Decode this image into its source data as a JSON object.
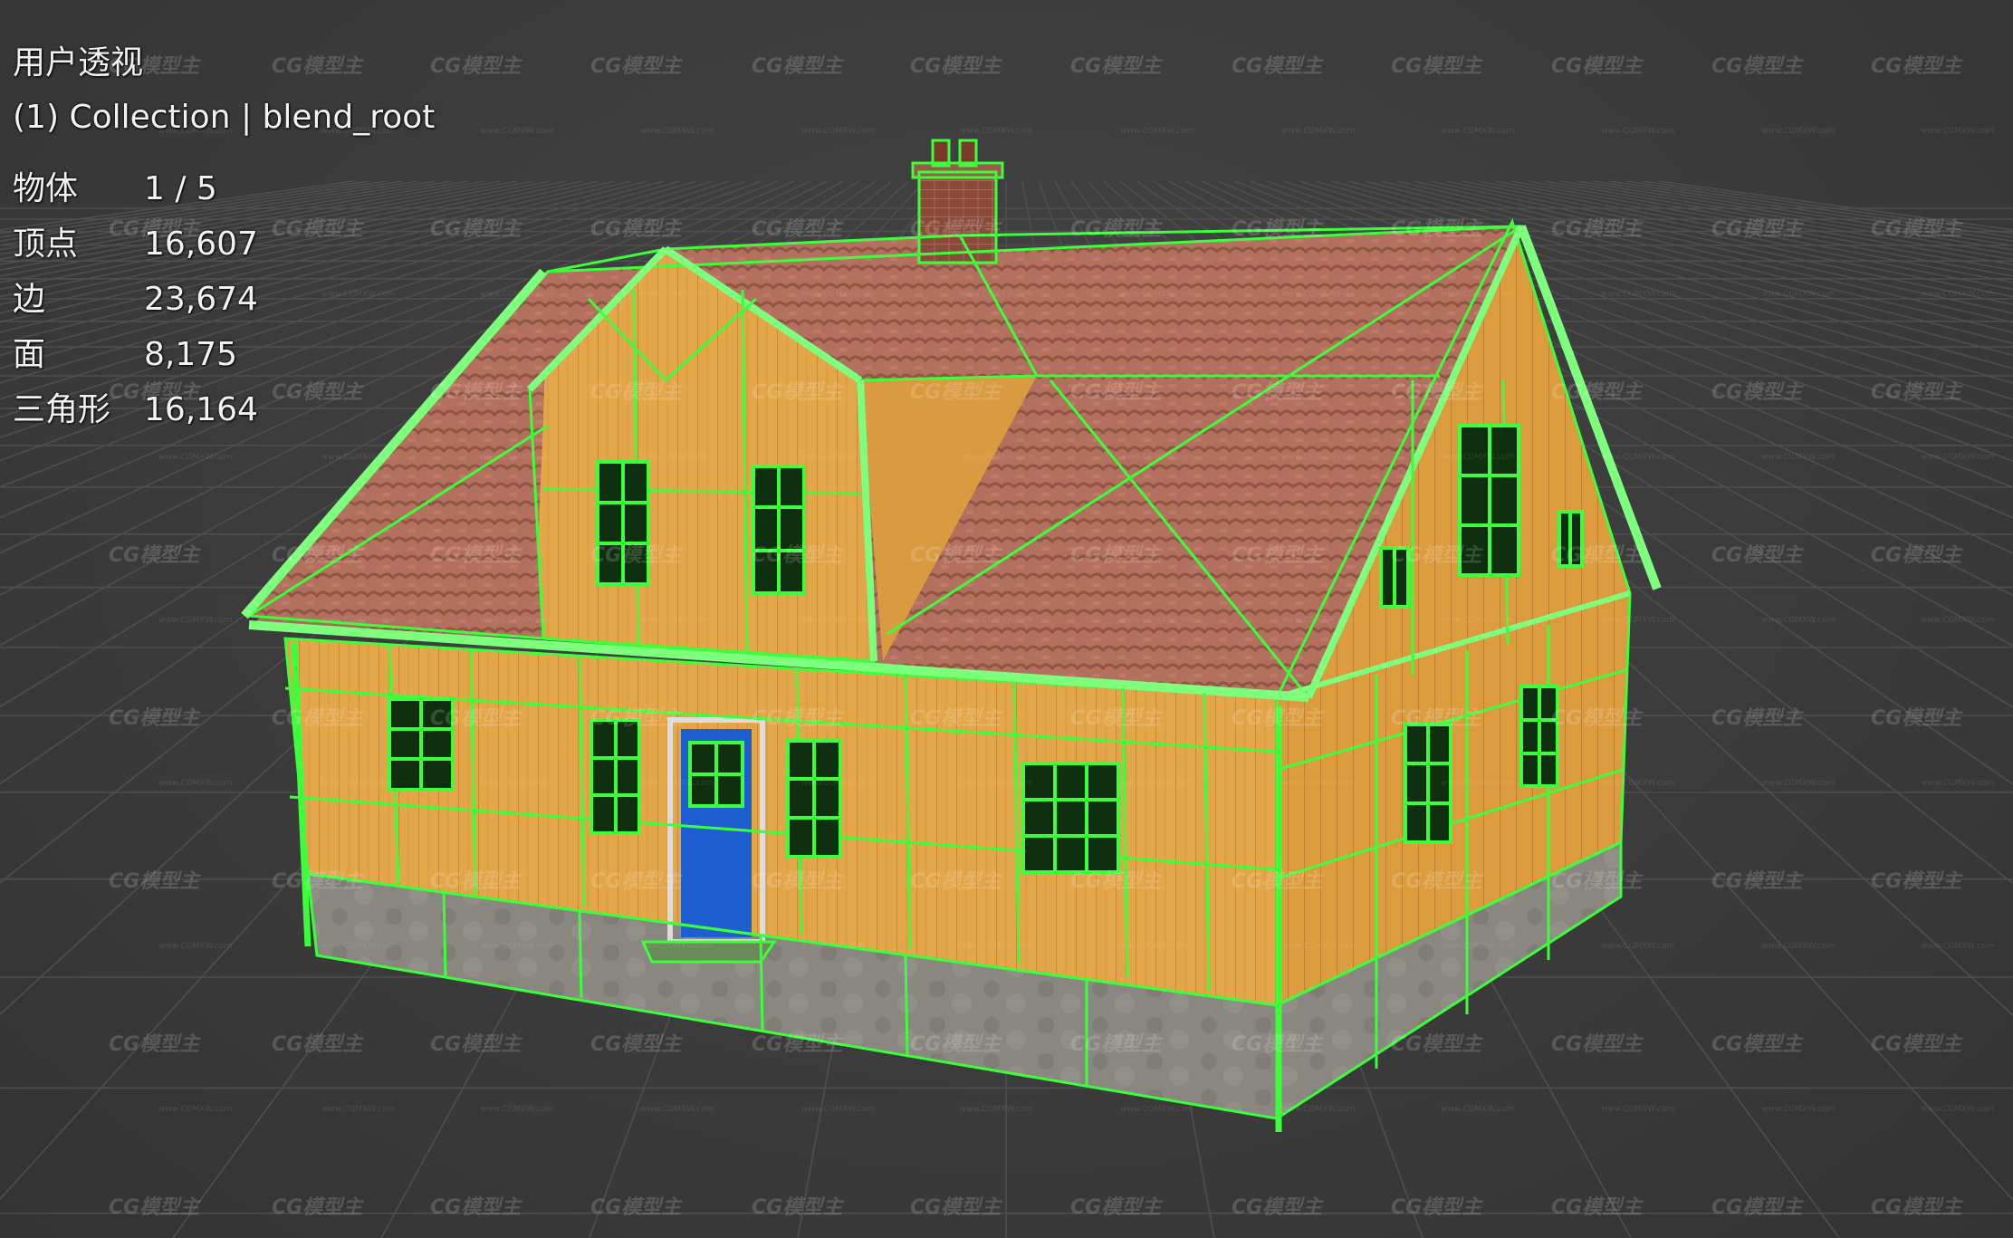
{
  "viewport": {
    "view_name": "用户透视",
    "collection_line": "(1) Collection | blend_root"
  },
  "stats": [
    {
      "label": "物体",
      "value": "1 / 5"
    },
    {
      "label": "顶点",
      "value": "16,607"
    },
    {
      "label": "边",
      "value": "23,674"
    },
    {
      "label": "面",
      "value": "8,175"
    },
    {
      "label": "三角形",
      "value": "16,164"
    }
  ],
  "watermark": {
    "text": "CG模型主",
    "sub_text": "www.CGMXW.com"
  },
  "colors": {
    "background": "#3a3a3a",
    "grid": "#4d4d4d",
    "wire": "#3cff3c",
    "wall": "#e3a648",
    "roof": "#b4705e",
    "foundation": "#8a8680",
    "door": "#1d5fd0",
    "chimney": "#8a4a3a"
  }
}
